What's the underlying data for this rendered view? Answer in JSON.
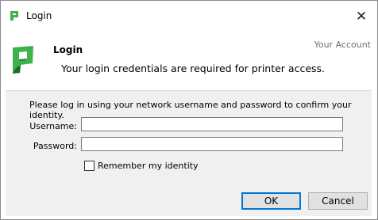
{
  "window": {
    "title": "Login",
    "close_glyph": "✕"
  },
  "header": {
    "title": "Login",
    "description": "Your login credentials are required for printer access.",
    "account_label": "Your Account"
  },
  "form": {
    "instructions": "Please log in using your network username and password to confirm your identity.",
    "username_label": "Username:",
    "username_value": "",
    "password_label": "Password:",
    "password_value": "",
    "remember_label": "Remember my identity",
    "remember_checked": false
  },
  "buttons": {
    "ok": "OK",
    "cancel": "Cancel"
  },
  "icons": {
    "app": "papercut-logo-icon",
    "close": "close-icon"
  },
  "colors": {
    "brand_green": "#3cb44b",
    "brand_dark": "#1e6b2c",
    "accent": "#0078d7"
  }
}
